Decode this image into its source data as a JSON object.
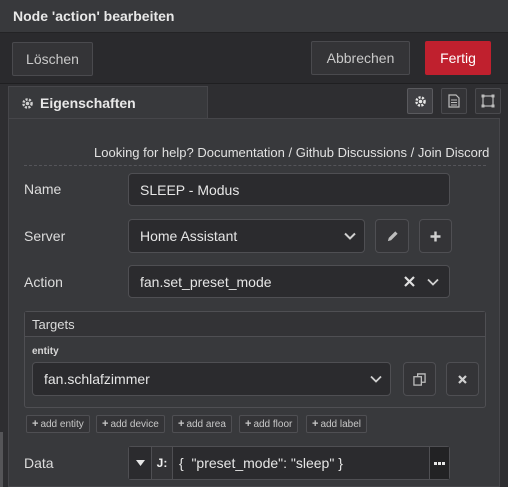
{
  "header": {
    "title": "Node 'action' bearbeiten"
  },
  "toolbar": {
    "delete_label": "Löschen",
    "cancel_label": "Abbrechen",
    "done_label": "Fertig"
  },
  "tabs": {
    "properties_label": "Eigenschaften"
  },
  "help": {
    "prefix": "Looking for help?",
    "links": [
      "Documentation",
      "Github Discussions",
      "Join Discord"
    ],
    "separator": "/"
  },
  "form": {
    "name": {
      "label": "Name",
      "value": "SLEEP - Modus"
    },
    "server": {
      "label": "Server",
      "value": "Home Assistant"
    },
    "action": {
      "label": "Action",
      "value": "fan.set_preset_mode"
    },
    "targets": {
      "title": "Targets",
      "entity_label": "entity",
      "entity_value": "fan.schlafzimmer",
      "chips": [
        "add entity",
        "add device",
        "add area",
        "add floor",
        "add label"
      ]
    },
    "data": {
      "label": "Data",
      "type_glyph": "J:",
      "value": "{  \"preset_mode\": \"sleep\" }"
    }
  },
  "colors": {
    "primary_button": "#c0202e",
    "background": "#2e2e31",
    "panel": "#38393c"
  },
  "icons": [
    "gear-icon",
    "document-icon",
    "frame-icon",
    "pencil-icon",
    "plus-icon",
    "clear-x-icon",
    "chevron-down-icon",
    "copy-icon",
    "close-icon",
    "caret-down-icon",
    "more-icon"
  ]
}
